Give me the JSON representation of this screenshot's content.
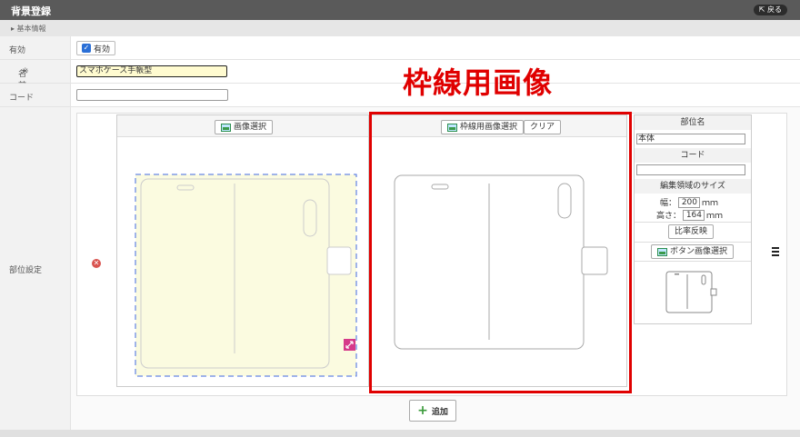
{
  "header": {
    "title": "背景登録",
    "back_label": "⇱ 戻る"
  },
  "section": {
    "label": "▸ 基本情報"
  },
  "form": {
    "enabled": {
      "label": "有効",
      "checkbox_label": "有効",
      "checked": true
    },
    "name": {
      "label": "名前",
      "required_mark": "※",
      "value": "スマホケース手帳型"
    },
    "code": {
      "label": "コード",
      "value": ""
    },
    "parts": {
      "label": "部位設定"
    }
  },
  "annotation": {
    "text": "枠線用画像"
  },
  "image_panel": {
    "select_label": "画像選択"
  },
  "frame_panel": {
    "select_label": "枠線用画像選択",
    "clear_label": "クリア"
  },
  "part_info": {
    "part_name_header": "部位名",
    "part_name_value": "本体",
    "code_header": "コード",
    "code_value": "",
    "size_header": "編集領域のサイズ",
    "width_label": "幅：",
    "width_value": "200",
    "height_label": "高さ：",
    "height_value": "164",
    "unit": "ｍｍ",
    "ratio_label": "比率反映",
    "button_image_label": "ボタン画像選択"
  },
  "add_label": "追加",
  "colors": {
    "highlight": "#e00000",
    "accent": "#2a6fd6",
    "edit_area": "#fbfbe0",
    "guide": "#4169e1",
    "resize_handle": "#d63a8a"
  }
}
